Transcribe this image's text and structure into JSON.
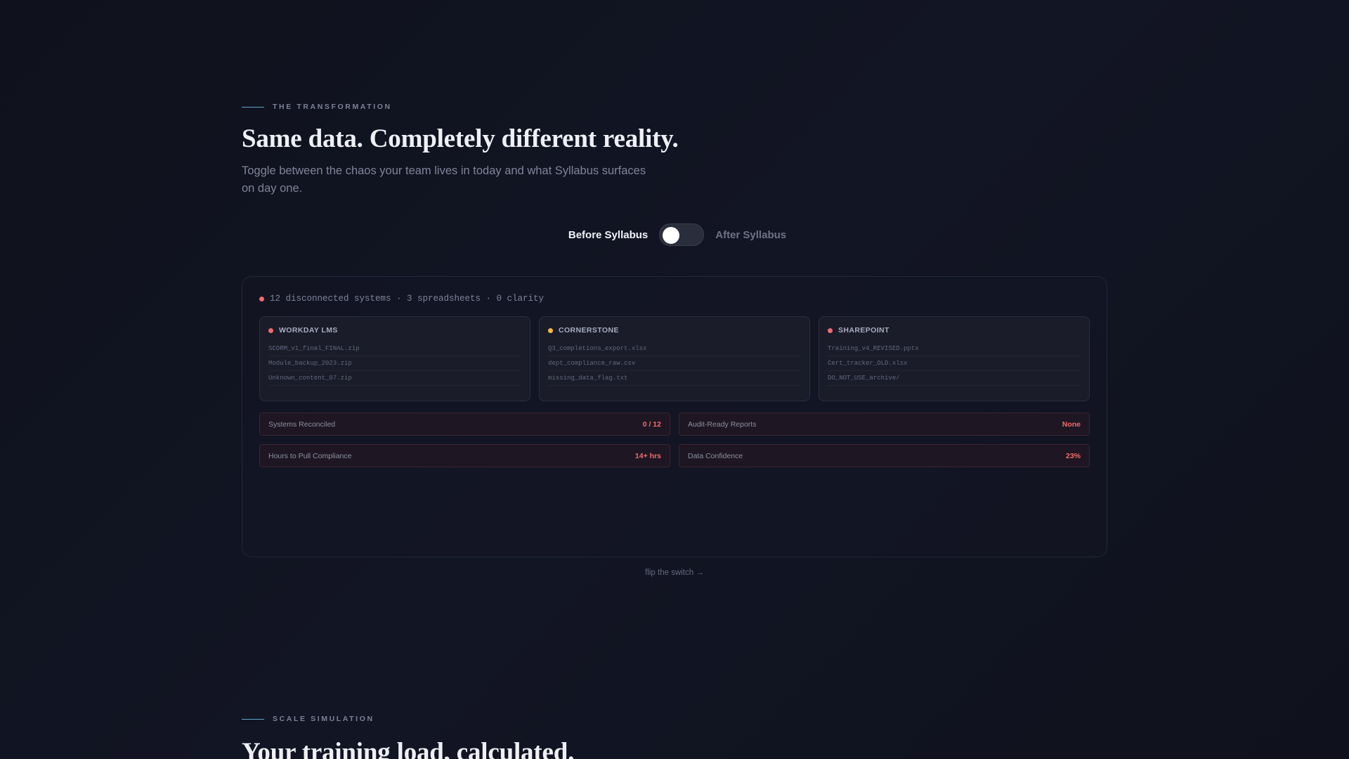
{
  "transformation": {
    "eyebrow": "THE TRANSFORMATION",
    "title": "Same data. Completely different reality.",
    "subtitle": "Toggle between the chaos your team lives in today and what Syllabus surfaces on day one."
  },
  "toggle": {
    "before_label": "Before Syllabus",
    "after_label": "After Syllabus",
    "state": "before"
  },
  "panel": {
    "status": "12 disconnected systems · 3 spreadsheets · 0 clarity",
    "systems": [
      {
        "name": "WORKDAY LMS",
        "status_color": "#f26b6b",
        "files": [
          "SCORM_v1_final_FINAL.zip",
          "Module_backup_2023.zip",
          "Unknown_content_07.zip"
        ]
      },
      {
        "name": "CORNERSTONE",
        "status_color": "#f5b942",
        "files": [
          "Q3_completions_export.xlsx",
          "dept_compliance_raw.csv",
          "missing_data_flag.txt"
        ]
      },
      {
        "name": "SHAREPOINT",
        "status_color": "#f26b6b",
        "files": [
          "Training_v4_REVISED.pptx",
          "Cert_tracker_OLD.xlsx",
          "DO_NOT_USE_archive/"
        ]
      }
    ],
    "metrics": [
      {
        "label": "Systems Reconciled",
        "value": "0 / 12"
      },
      {
        "label": "Audit-Ready Reports",
        "value": "None"
      },
      {
        "label": "Hours to Pull Compliance",
        "value": "14+ hrs"
      },
      {
        "label": "Data Confidence",
        "value": "23%"
      }
    ]
  },
  "hint": "flip the switch →",
  "scale": {
    "eyebrow": "SCALE SIMULATION",
    "title": "Your training load, calculated."
  },
  "colors": {
    "accent_line": "#5fa8c9",
    "danger": "#f26b6b",
    "warning": "#f5b942"
  }
}
